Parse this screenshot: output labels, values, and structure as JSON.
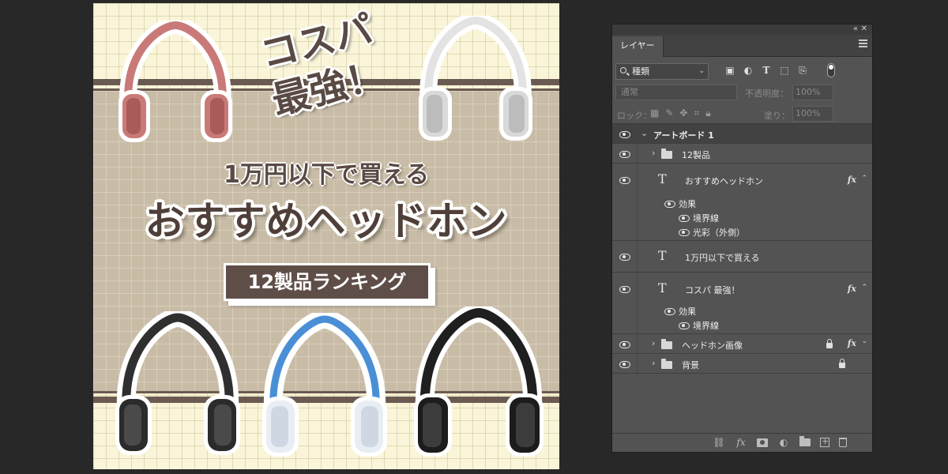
{
  "canvas": {
    "headline_tag": "コスパ",
    "headline_tag_2": "最強！",
    "subheadline": "1万円以下で買える",
    "headline": "おすすめヘッドホン",
    "ranking_badge": "12製品ランキング"
  },
  "panel": {
    "tab_label": "レイヤー",
    "filter": {
      "value": "種類"
    },
    "blend": {
      "value": "通常",
      "opacity_label": "不透明度：",
      "opacity_value": "100%"
    },
    "lock": {
      "label": "ロック：",
      "fill_label": "塗り：",
      "fill_value": "100%"
    },
    "layers": [
      {
        "name": "アートボード 1",
        "type": "artboard"
      },
      {
        "name": "12製品",
        "type": "group"
      },
      {
        "name": "おすすめヘッドホン",
        "type": "text",
        "fx": "fx",
        "effects_label": "効果",
        "effects": [
          "境界線",
          "光彩（外側）"
        ]
      },
      {
        "name": "1万円以下で買える",
        "type": "text"
      },
      {
        "name": "コスパ 最強！",
        "type": "text",
        "fx": "fx",
        "effects_label": "効果",
        "effects": [
          "境界線"
        ]
      },
      {
        "name": "ヘッドホン画像",
        "type": "group",
        "fx": "fx",
        "locked": true
      },
      {
        "name": "背景",
        "type": "group",
        "locked": true
      }
    ]
  },
  "colors": {
    "canvas_bg": "#faf5d9",
    "band": "#c9bca6",
    "brown_text": "#5a4a44",
    "panel_bg": "#535353",
    "workspace_bg": "#282828"
  }
}
